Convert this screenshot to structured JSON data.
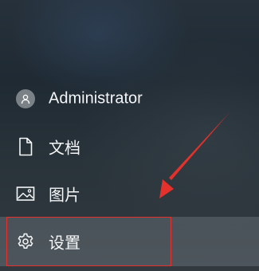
{
  "start_menu": {
    "user": {
      "label": "Administrator",
      "icon": "user-avatar-icon"
    },
    "items": [
      {
        "label": "文档",
        "icon": "document-icon"
      },
      {
        "label": "图片",
        "icon": "image-icon"
      },
      {
        "label": "设置",
        "icon": "gear-icon"
      }
    ]
  },
  "annotation": {
    "color": "#e4312b",
    "highlight": "settings item",
    "arrow": "pointing to settings"
  },
  "colors": {
    "text": "#f4f6f8",
    "selected_background": "rgba(150,158,164,0.28)"
  }
}
